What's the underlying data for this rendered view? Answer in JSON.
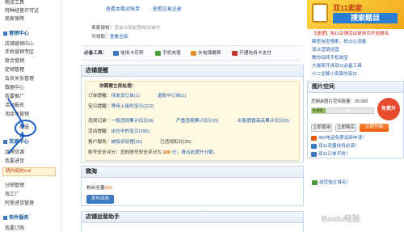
{
  "sidebar": {
    "items_top": [
      "物流工具",
      "特种经营许可证",
      "商家保障"
    ],
    "section_marketing": "营销中心",
    "items_marketing": [
      "店铺营销中心",
      "手机营销专区",
      "联合营销",
      "促销管理",
      "会员关系管理",
      "数据中心",
      "我要推广",
      "活动报名",
      "淘金币营销",
      "心选"
    ],
    "section_goods": "货源中心",
    "items_goods": [
      "品牌货源",
      "我要进货"
    ],
    "hot_promo": "跳你疯抢hot!",
    "items_goods2": [
      "分销管理",
      "淘工厂",
      "阿里进货管理"
    ],
    "section_service": "软件服务",
    "items_service": [
      "我要订购"
    ]
  },
  "top": {
    "links": [
      "查看本期对账单",
      "查看交易记录"
    ],
    "auth_label": "卖家授权：",
    "auth_value": "货金业和前程相关操作",
    "withdraw_label": "可领取：",
    "withdraw_value": "查看全部",
    "service_label": "必备工具：",
    "tools": [
      "信用卡花呗",
      "手机充值",
      "水电煤缴费",
      "开通信用卡支付"
    ]
  },
  "reminder": {
    "title": "店铺提醒",
    "pending_title": "你需要立即处理：",
    "order_label": "订单提醒：",
    "order_items": [
      "待发货订单(1)",
      "退款中订单(1)"
    ],
    "goods_label": "宝贝提醒：",
    "goods_items": [
      "等待上架的宝贝(222)"
    ],
    "violation_label": "违规记录：",
    "violation_items": [
      "一般违规累计扣分(0)",
      "严重违规累计扣分(0)",
      "出售假冒商品累计扣分(0)"
    ],
    "activity_label": "活动提醒：",
    "activity_items": [
      "出仓中的宝贝(295)"
    ],
    "service_label": "客户服务：",
    "service_items": [
      "被投诉处理(20)",
      "已违规扣分(25)"
    ],
    "account_label": "账号安全评分：",
    "account_text": "您的账号安全评分为",
    "account_score": "100",
    "account_suffix": "分，请点此提升分数。"
  },
  "weitao": {
    "title": "微淘",
    "fans_label": "粉丝总量",
    "fans_value": "692",
    "post_button": "发布动态"
  },
  "ops": {
    "title": "店铺运营助手"
  },
  "right": {
    "banner_badge": "双11卖家",
    "banner_title": "搜索题目",
    "banner_subtitle": "收缩教师",
    "news": [
      "【速递】淘11店铺活动录排页开始报名",
      "解密淘宝搜索，抢占心流量",
      "双11营销运营",
      "教你玩转手机淘宝",
      "大咖来开讲双11必备工具",
      "小二全解小卖家的双11"
    ],
    "img_space_title": "图片空间",
    "used_label": "您剩余图片空间容量：20.000",
    "size_text": "已使用容量：",
    "used_value": "4.406",
    "total_value": "20",
    "free_button": "立即使用",
    "buy_button": "立即购买",
    "upgrade_button": "立即升级",
    "badge_text": "免费升",
    "list_items": [
      "400电话免费试用申请！",
      "双11流量扶持必读！",
      "双11订单开抢！",
      "送您独立域名！"
    ]
  },
  "colors": {
    "accent": "#1d5aa8",
    "orange": "#e85a0c",
    "red": "#d2261a",
    "banner": "#f7bc2a"
  }
}
